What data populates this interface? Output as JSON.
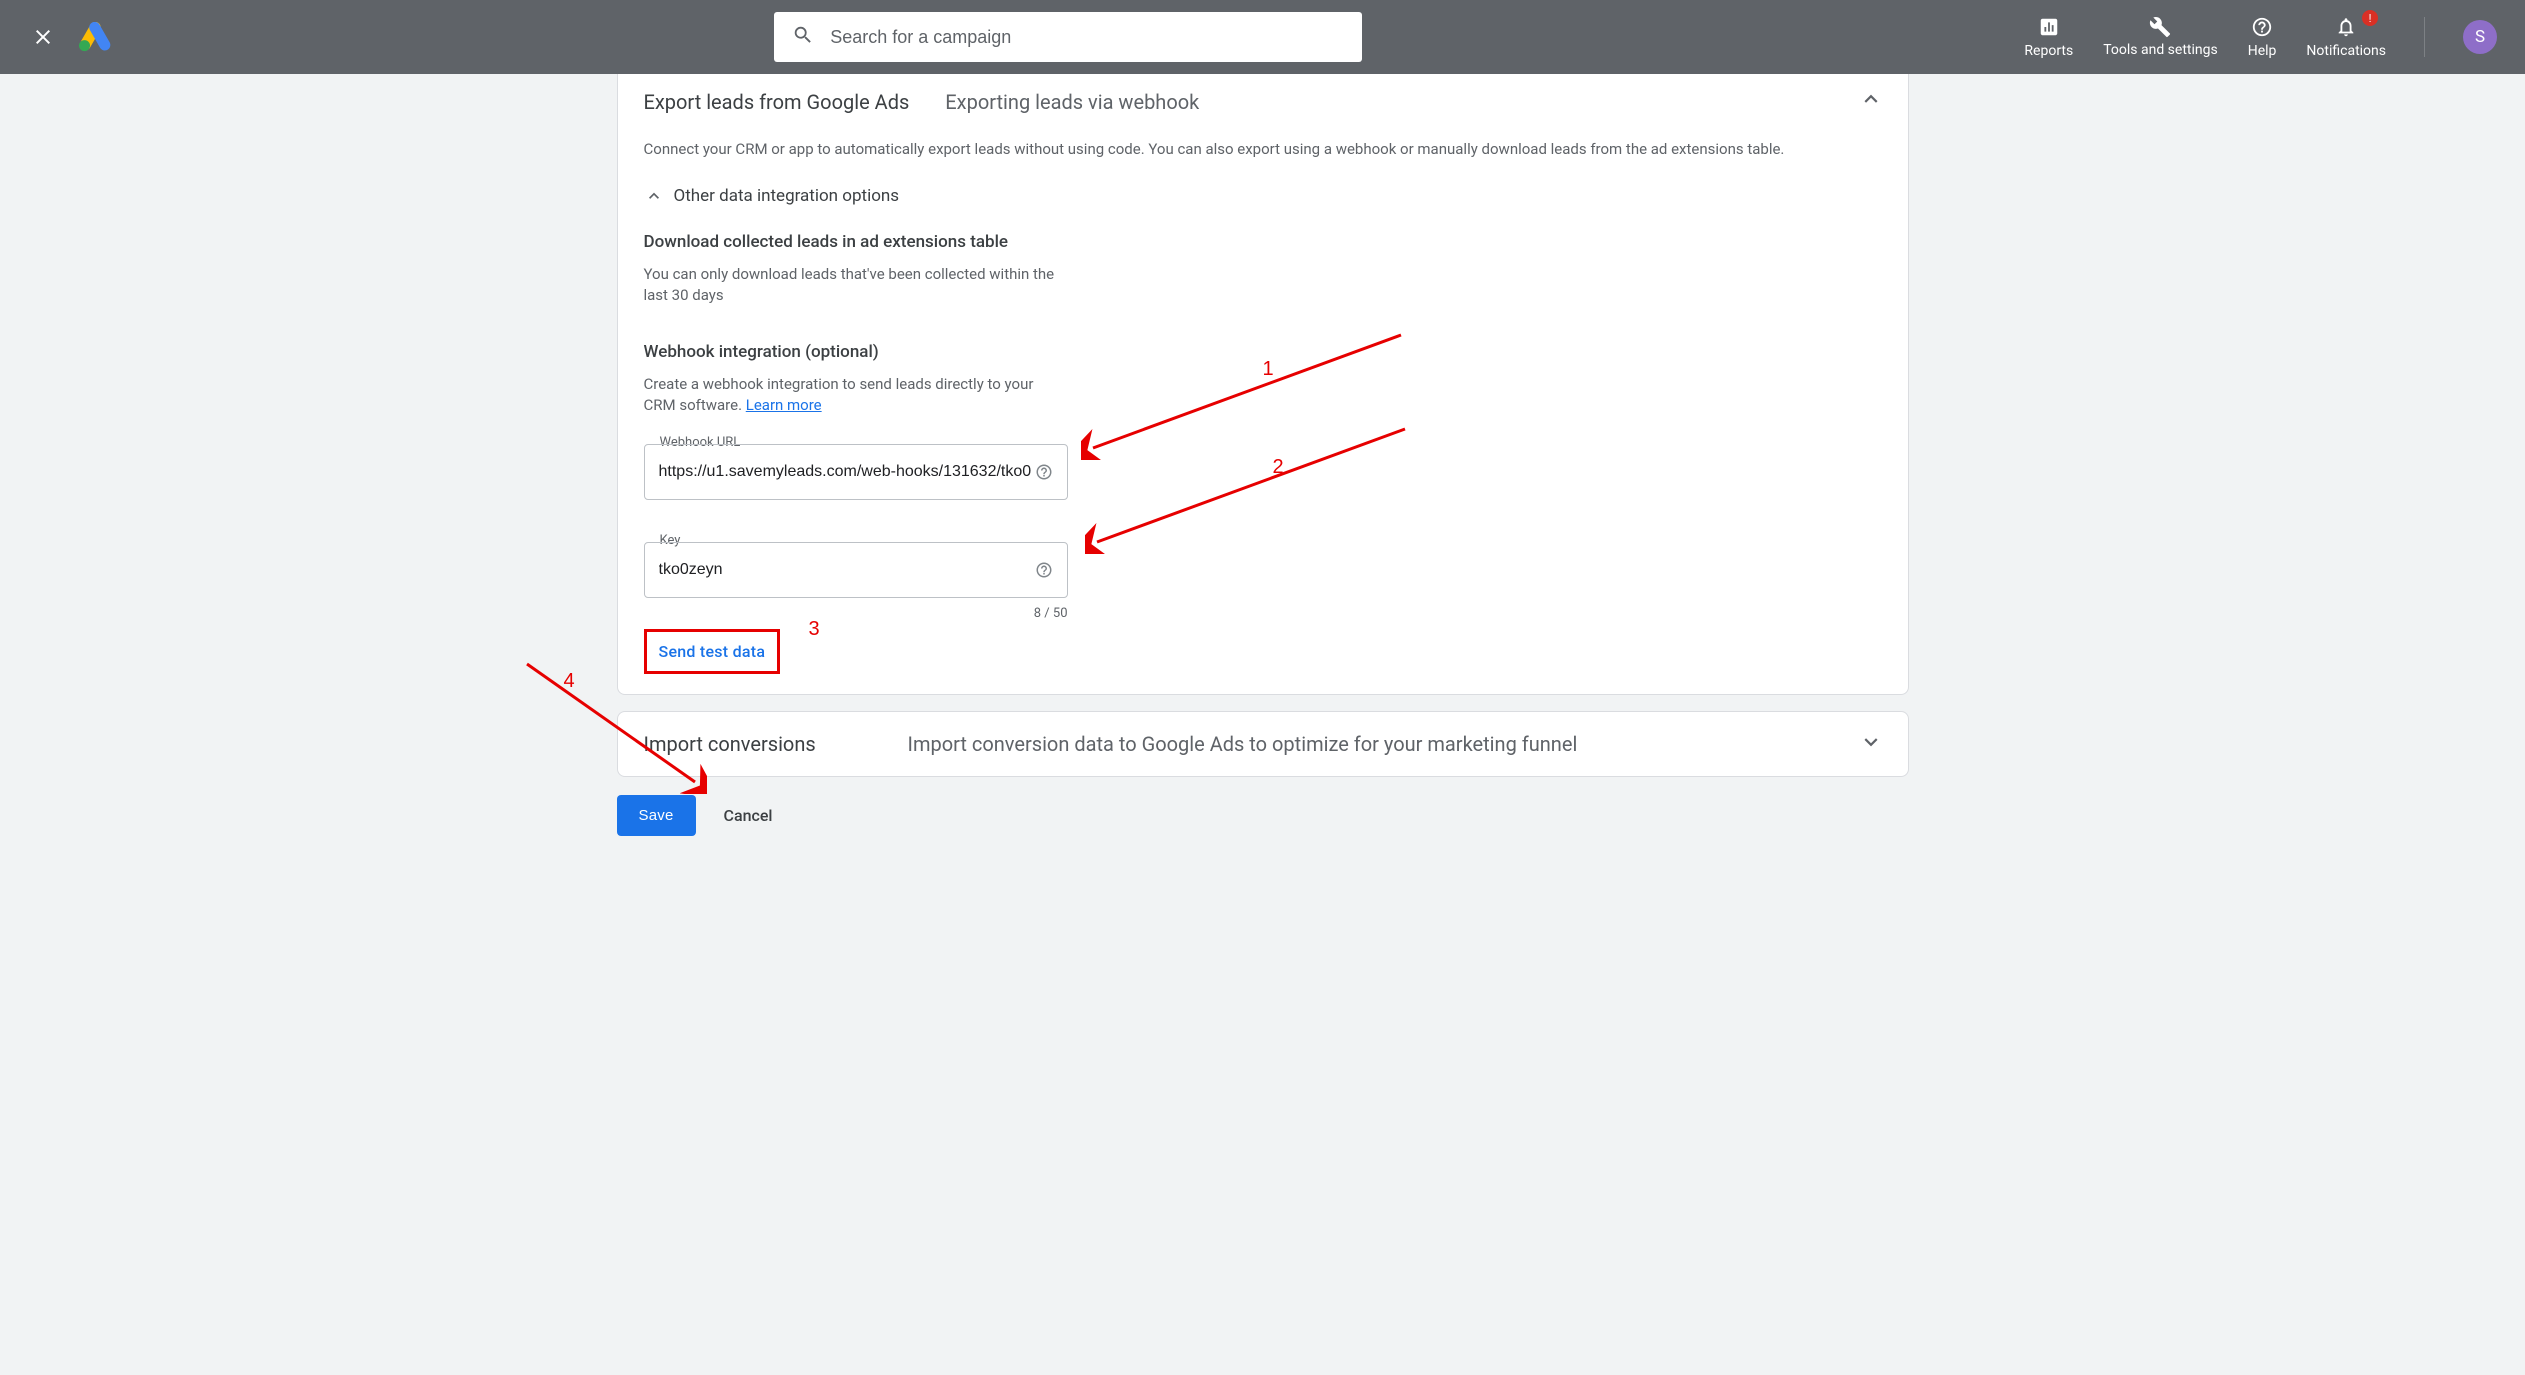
{
  "header": {
    "search_placeholder": "Search for a campaign",
    "actions": {
      "reports": "Reports",
      "tools": "Tools and settings",
      "help": "Help",
      "notifications": "Notifications",
      "notif_badge": "!"
    },
    "avatar_initial": "S"
  },
  "main": {
    "title_primary": "Export leads from Google Ads",
    "title_secondary": "Exporting leads via webhook",
    "intro": "Connect your CRM or app to automatically export leads without using code. You can also export using a webhook or manually download leads from the ad extensions table.",
    "other_options_label": "Other data integration options",
    "download_title": "Download collected leads in ad extensions table",
    "download_desc": "You can only download leads that've been collected within the last 30 days",
    "webhook_title": "Webhook integration (optional)",
    "webhook_desc_pre": "Create a webhook integration to send leads directly to your CRM software. ",
    "webhook_learn_more": "Learn more",
    "webhook_url_label": "Webhook URL",
    "webhook_url_value": "https://u1.savemyleads.com/web-hooks/131632/tko0",
    "key_label": "Key",
    "key_value": "tko0zeyn",
    "key_counter": "8 / 50",
    "send_test_label": "Send test data"
  },
  "import": {
    "title": "Import conversions",
    "desc": "Import conversion data to Google Ads to optimize for your marketing funnel"
  },
  "footer": {
    "save": "Save",
    "cancel": "Cancel"
  },
  "annotations": {
    "n1": "1",
    "n2": "2",
    "n3": "3",
    "n4": "4"
  }
}
